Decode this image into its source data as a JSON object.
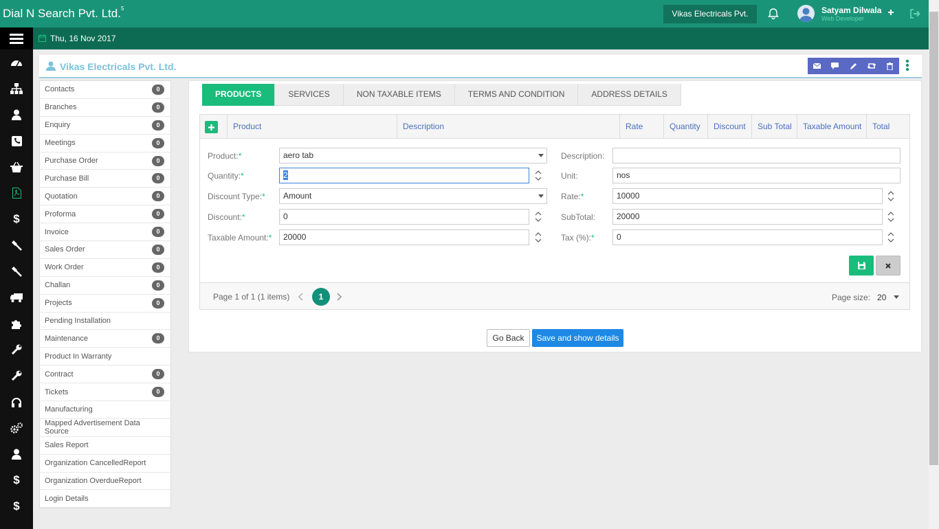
{
  "header": {
    "brand": "Dial N Search Pvt. Ltd.",
    "brand_sup": "5",
    "org_button": "Vikas Electricals Pvt.",
    "user_name": "Satyam Dilwala",
    "user_role": "Web Developer"
  },
  "subheader": {
    "date": "Thu, 16 Nov 2017"
  },
  "page": {
    "title": "Vikas Electricals Pvt. Ltd."
  },
  "sidebar": {
    "items": [
      {
        "label": "Contacts",
        "count": "0"
      },
      {
        "label": "Branches",
        "count": "0"
      },
      {
        "label": "Enquiry",
        "count": "0"
      },
      {
        "label": "Meetings",
        "count": "0"
      },
      {
        "label": "Purchase Order",
        "count": "0"
      },
      {
        "label": "Purchase Bill",
        "count": "0"
      },
      {
        "label": "Quotation",
        "count": "0"
      },
      {
        "label": "Proforma",
        "count": "0"
      },
      {
        "label": "Invoice",
        "count": "0"
      },
      {
        "label": "Sales Order",
        "count": "0"
      },
      {
        "label": "Work Order",
        "count": "0"
      },
      {
        "label": "Challan",
        "count": "0"
      },
      {
        "label": "Projects",
        "count": "0"
      },
      {
        "label": "Pending Installation",
        "count": null
      },
      {
        "label": "Maintenance",
        "count": "0"
      },
      {
        "label": "Product In Warranty",
        "count": null
      },
      {
        "label": "Contract",
        "count": "0"
      },
      {
        "label": "Tickets",
        "count": "0"
      },
      {
        "label": "Manufacturing",
        "count": null
      },
      {
        "label": "Mapped Advertisement Data Source",
        "count": null
      },
      {
        "label": "Sales Report",
        "count": null
      },
      {
        "label": "Organization CancelledReport",
        "count": null
      },
      {
        "label": "Organization OverdueReport",
        "count": null
      },
      {
        "label": "Login Details",
        "count": null
      }
    ]
  },
  "tabs": [
    "PRODUCTS",
    "SERVICES",
    "NON TAXABLE ITEMS",
    "TERMS AND CONDITION",
    "ADDRESS DETAILS"
  ],
  "grid": {
    "columns": [
      "Product",
      "Description",
      "Rate",
      "Quantity",
      "Discount",
      "Sub Total",
      "Taxable Amount",
      "Total"
    ]
  },
  "form": {
    "product_label": "Product:",
    "product_value": "aero tab",
    "description_label": "Description:",
    "description_value": "",
    "quantity_label": "Quantity:",
    "quantity_value": "2",
    "unit_label": "Unit:",
    "unit_value": "nos",
    "discount_type_label": "Discount Type:",
    "discount_type_value": "Amount",
    "rate_label": "Rate:",
    "rate_value": "10000",
    "discount_label": "Discount:",
    "discount_value": "0",
    "subtotal_label": "SubTotal:",
    "subtotal_value": "20000",
    "taxable_label": "Taxable Amount:",
    "taxable_value": "20000",
    "tax_label": "Tax (%):",
    "tax_value": "0",
    "required_mark": "*"
  },
  "pager": {
    "info": "Page 1 of 1 (1 items)",
    "current_page": "1",
    "page_size_label": "Page size:",
    "page_size": "20"
  },
  "buttons": {
    "go_back": "Go Back",
    "save_details": "Save and show details"
  },
  "colors": {
    "header": "#1a9478",
    "subheader": "#0e6b53",
    "accent": "#1abc7b",
    "action_bar": "#5a69c4",
    "primary_button": "#1e88e5"
  }
}
